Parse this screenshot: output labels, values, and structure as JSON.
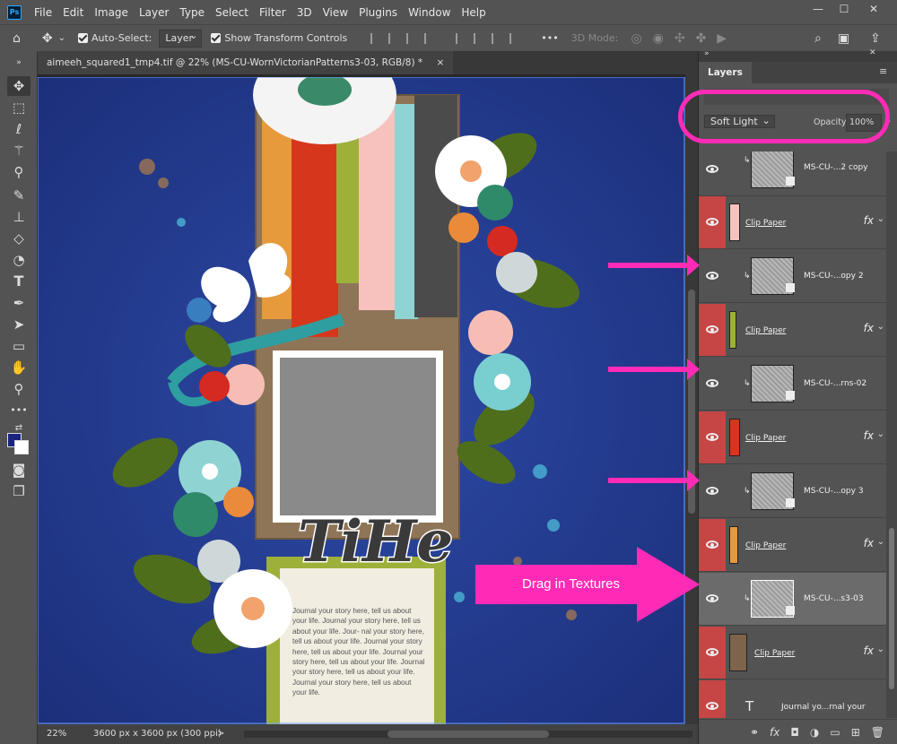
{
  "menu": {
    "logo": "Ps",
    "items": [
      "File",
      "Edit",
      "Image",
      "Layer",
      "Type",
      "Select",
      "Filter",
      "3D",
      "View",
      "Plugins",
      "Window",
      "Help"
    ]
  },
  "options": {
    "auto_select_label": "Auto-Select:",
    "auto_select_value": "Layer",
    "transform_label": "Show Transform Controls",
    "more": "•••",
    "mode_3d": "3D Mode:"
  },
  "document": {
    "tab_title": "aimeeh_squared1_tmp4.tif @ 22% (MS-CU-WornVictorianPatterns3-03, RGB/8) *",
    "close": "×"
  },
  "status": {
    "zoom": "22%",
    "doc_info": "3600 px x 3600 px (300 ppi)",
    "arrow": ">"
  },
  "artwork": {
    "title_word": "TiHe",
    "journal_text": "Journal your story here, tell us about your life. Journal your story here, tell us about your life. Jour- nal your story here, tell us about your life. Journal your story here, tell us about your life. Journal your story here, tell us about your life. Journal your story here, tell us about your life. Journal your story here, tell us about your life."
  },
  "layers_panel": {
    "tab_label": "Layers",
    "blend_mode": "Soft Light",
    "opacity_label": "Opacity:",
    "opacity_value": "100%",
    "layers": [
      {
        "name": "MS-CU-...2 copy",
        "kind": "texture"
      },
      {
        "name": "Clip Paper",
        "kind": "paper",
        "color": "#f7c2bd"
      },
      {
        "name": "MS-CU-...opy 2",
        "kind": "texture"
      },
      {
        "name": "Clip Paper",
        "kind": "paper",
        "color": "#9db03a"
      },
      {
        "name": "MS-CU-...rns-02",
        "kind": "texture"
      },
      {
        "name": "Clip Paper",
        "kind": "paper",
        "color": "#d6371c"
      },
      {
        "name": "MS-CU-...opy 3",
        "kind": "texture"
      },
      {
        "name": "Clip Paper",
        "kind": "paper",
        "color": "#e79a3b"
      },
      {
        "name": "MS-CU-...s3-03",
        "kind": "texture",
        "selected": true
      },
      {
        "name": "Clip Paper",
        "kind": "paper",
        "color": "#7d644a"
      },
      {
        "name": "Journal yo...rnal your",
        "kind": "text",
        "glyph": "T"
      }
    ]
  },
  "annotation": {
    "drag_label": "Drag in Textures",
    "highlight_color": "#ff2bb6"
  }
}
